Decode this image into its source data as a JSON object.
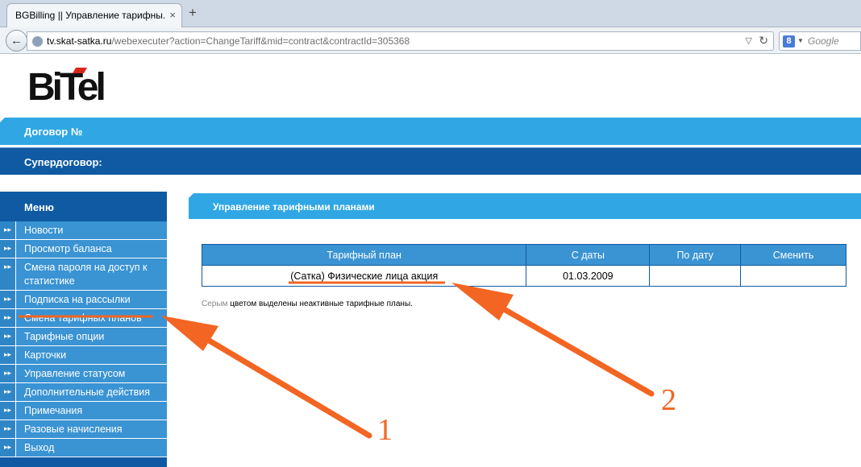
{
  "browser": {
    "tab_title": "BGBilling || Управление тарифны...",
    "tab_close": "×",
    "new_tab": "+",
    "url_host": "tv.skat-satka.ru",
    "url_path": "/webexecuter?action=ChangeTariff&mid=contract&contractId=305368",
    "search_placeholder": "Google",
    "search_engine_letter": "8"
  },
  "logo": {
    "text": "BiTel"
  },
  "header": {
    "contract_label": "Договор №",
    "supercontract_label": "Супердоговор:"
  },
  "menu": {
    "title": "Меню",
    "items": [
      {
        "label": "Новости"
      },
      {
        "label": "Просмотр баланса"
      },
      {
        "label": "Смена пароля на доступ к статистике"
      },
      {
        "label": "Подписка на рассылки"
      },
      {
        "label": "Смена тарифных планов"
      },
      {
        "label": "Тарифные опции"
      },
      {
        "label": "Карточки"
      },
      {
        "label": "Управление статусом"
      },
      {
        "label": "Дополнительные действия"
      },
      {
        "label": "Примечания"
      },
      {
        "label": "Разовые начисления"
      },
      {
        "label": "Выход"
      }
    ]
  },
  "content": {
    "title": "Управление тарифными планами",
    "table": {
      "headers": [
        "Тарифный план",
        "С даты",
        "По дату",
        "Сменить"
      ],
      "rows": [
        [
          "(Сатка) Физические лица акция",
          "01.03.2009",
          "",
          ""
        ]
      ]
    },
    "note_grey": "Серым",
    "note_rest": " цветом выделены неактивные тарифные планы."
  },
  "annotations": {
    "color": "#f26522",
    "label_1": "1",
    "label_2": "2"
  }
}
